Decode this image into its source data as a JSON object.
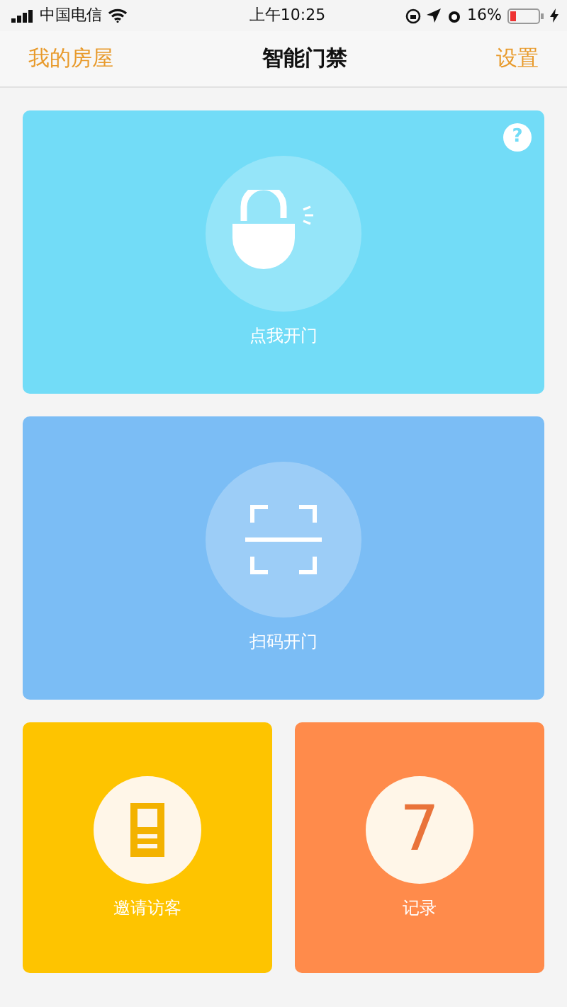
{
  "status_bar": {
    "carrier": "中国电信",
    "time": "上午10:25",
    "battery": "16%"
  },
  "nav": {
    "left": "我的房屋",
    "title": "智能门禁",
    "right": "设置"
  },
  "tiles": [
    {
      "kind": "lock",
      "label": "点我开门",
      "color": "#72dcf7",
      "help": "?"
    },
    {
      "kind": "scan",
      "label": "扫码开门",
      "color": "#7bbdf5"
    },
    {
      "kind": "invite",
      "label": "邀请访客",
      "color": "#fec400"
    },
    {
      "kind": "record",
      "label": "记录",
      "color": "#ff8b4b",
      "glyph": "7"
    }
  ]
}
